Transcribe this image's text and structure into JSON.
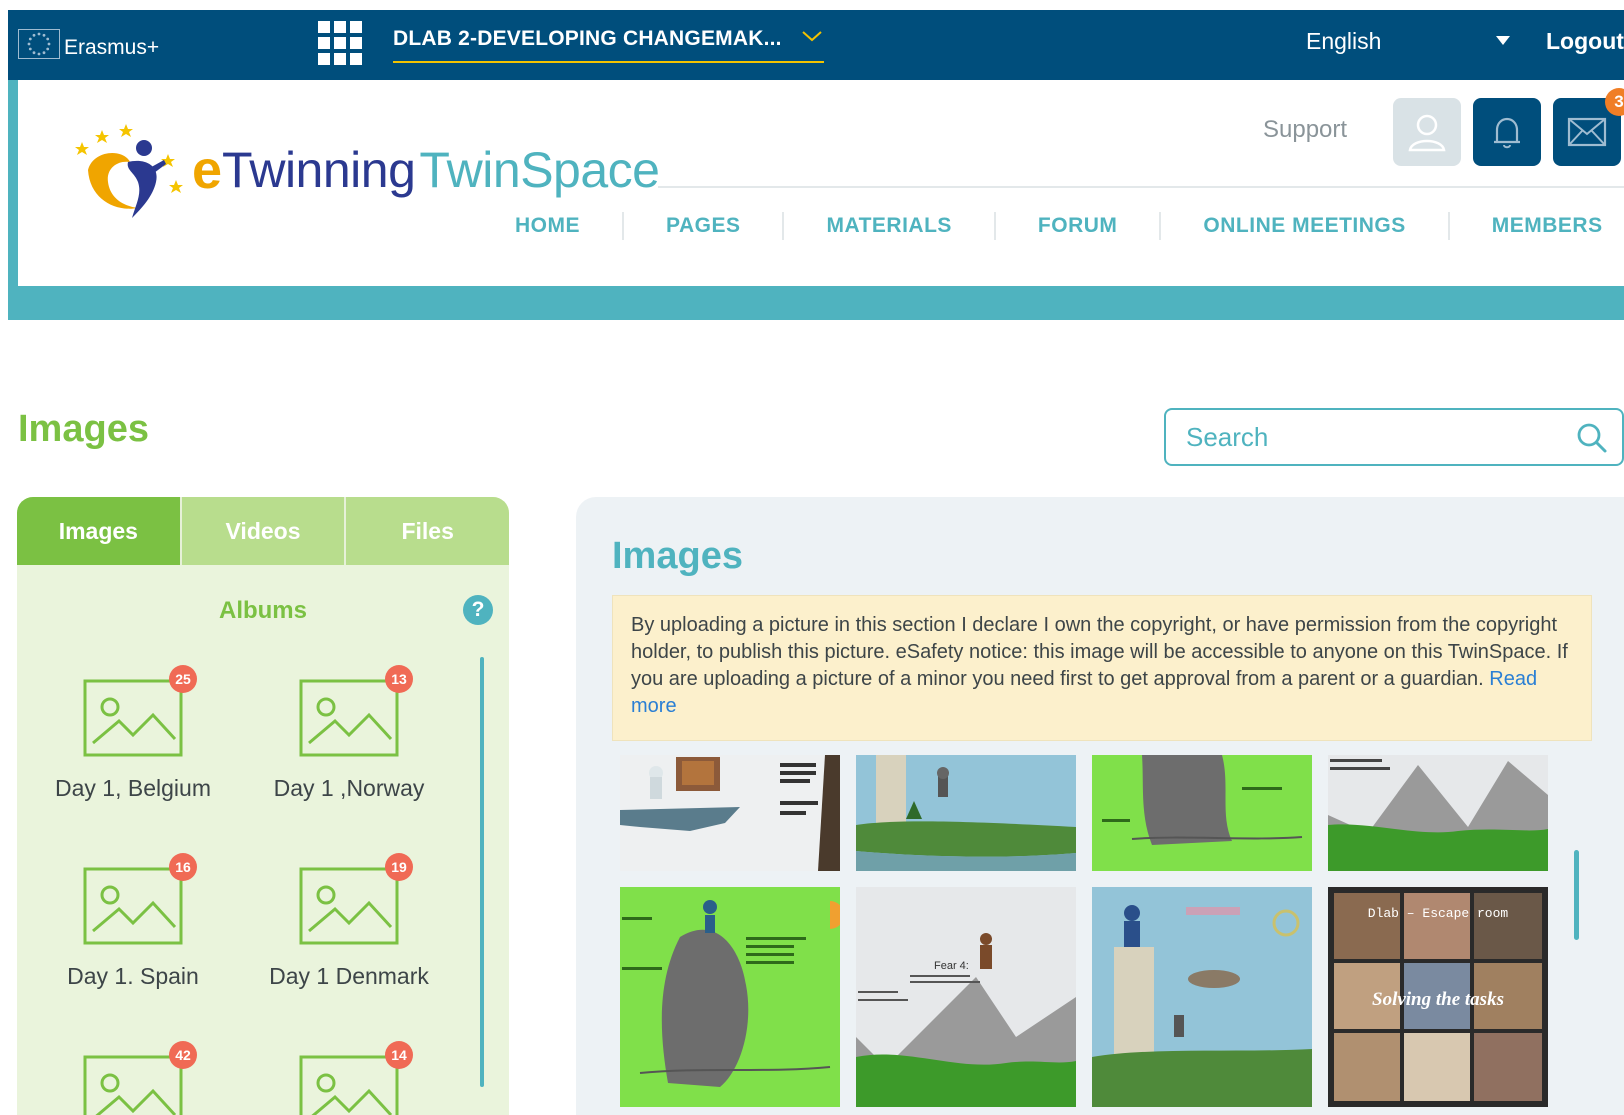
{
  "topbar": {
    "brand": "Erasmus+",
    "project": "DLAB 2-DEVELOPING CHANGEMAK...",
    "language": "English",
    "logout": "Logout"
  },
  "header": {
    "logo_e": "e",
    "logo_twinning": "Twinning",
    "logo_twinspace": "TwinSpace",
    "support": "Support",
    "mail_count": "3",
    "nav": [
      "HOME",
      "PAGES",
      "MATERIALS",
      "FORUM",
      "ONLINE MEETINGS",
      "MEMBERS"
    ]
  },
  "page": {
    "title": "Images",
    "search_placeholder": "Search"
  },
  "left_panel": {
    "tabs": [
      "Images",
      "Videos",
      "Files"
    ],
    "active_tab": "Images",
    "albums_title": "Albums",
    "help": "?",
    "albums": [
      {
        "label": "Day 1, Belgium",
        "count": "25"
      },
      {
        "label": "Day 1 ,Norway",
        "count": "13"
      },
      {
        "label": "Day 1. Spain",
        "count": "16"
      },
      {
        "label": "Day 1 Denmark",
        "count": "19"
      },
      {
        "label": "",
        "count": "42"
      },
      {
        "label": "",
        "count": "14"
      }
    ]
  },
  "right_panel": {
    "title": "Images",
    "notice": "By uploading a picture in this section I declare I own the copyright, or have permission from the copyright holder, to publish this picture. eSafety notice: this image will be accessible to anyone on this TwinSpace. If you are uploading a picture of a minor you need first to get approval from a parent or a guardian. ",
    "read_more": "Read more",
    "image_texts": {
      "fear4": "Fear 4:",
      "escape_room": "Dlab – Escape room",
      "solving": "Solving the tasks"
    }
  },
  "colors": {
    "topbar": "#004e7c",
    "teal": "#4fb3bf",
    "green": "#7bc143",
    "badge_orange": "#f07e26",
    "album_badge": "#f06a55"
  }
}
